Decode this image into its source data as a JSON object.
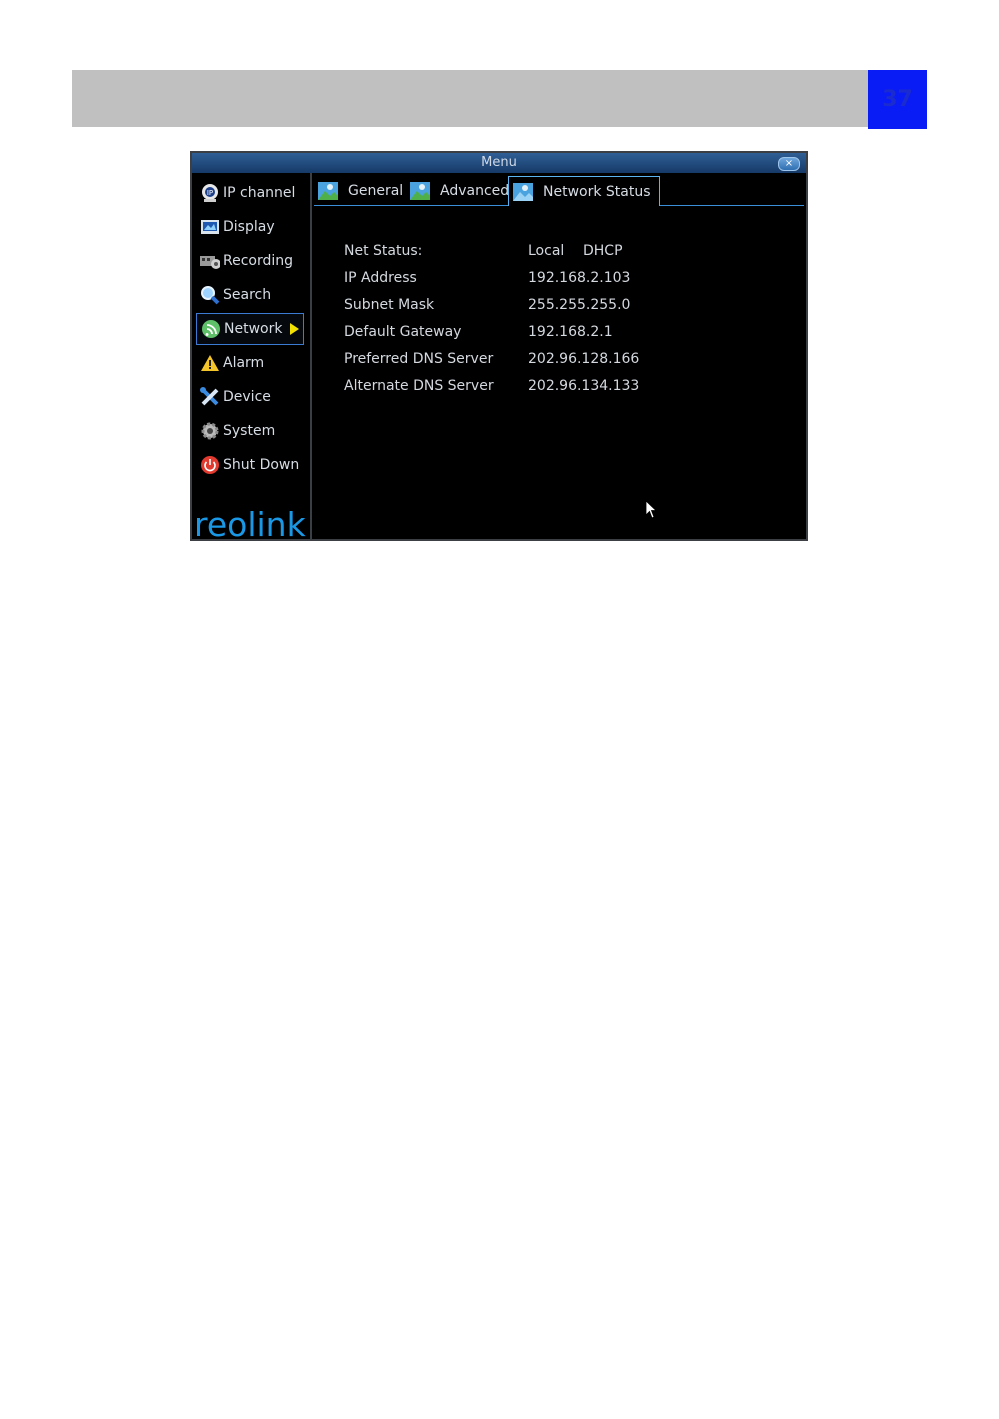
{
  "page": {
    "number": "37"
  },
  "window": {
    "title": "Menu",
    "close_label": "×"
  },
  "sidebar": {
    "items": [
      {
        "label": "IP channel"
      },
      {
        "label": "Display"
      },
      {
        "label": "Recording"
      },
      {
        "label": "Search"
      },
      {
        "label": "Network"
      },
      {
        "label": "Alarm"
      },
      {
        "label": "Device"
      },
      {
        "label": "System"
      },
      {
        "label": "Shut Down"
      }
    ],
    "active": "Network",
    "logo_text": "reolink"
  },
  "tabs": [
    {
      "label": "General"
    },
    {
      "label": "Advanced"
    },
    {
      "label": "Network Status"
    }
  ],
  "network_status": {
    "rows": [
      {
        "label": "Net Status:",
        "value": "Local",
        "value2": "DHCP"
      },
      {
        "label": "IP Address",
        "value": "192.168.2.103"
      },
      {
        "label": "Subnet Mask",
        "value": "255.255.255.0"
      },
      {
        "label": "Default Gateway",
        "value": "192.168.2.1"
      },
      {
        "label": "Preferred DNS Server",
        "value": "202.96.128.166"
      },
      {
        "label": "Alternate DNS Server",
        "value": "202.96.134.133"
      }
    ]
  },
  "colors": {
    "header_gray": "#c0c0c0",
    "page_badge": "#0a1cf5",
    "accent": "#3b8fd9",
    "logo": "#1a98e6"
  }
}
